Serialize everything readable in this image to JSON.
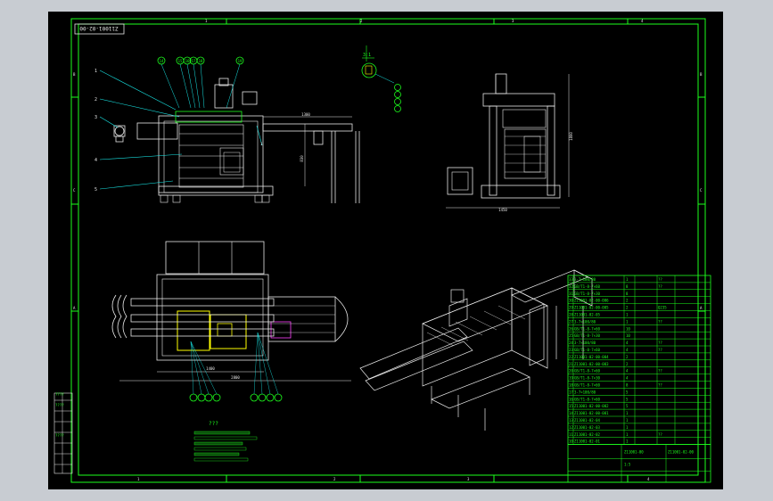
{
  "drawing": {
    "title_box_text": "Z11001-02-00",
    "dims": {
      "top_width": "1300",
      "top_height": "830",
      "side_width": "1450",
      "side_height": "1800",
      "plan_inner": "1400",
      "plan_outer": "2800"
    },
    "callouts_left": [
      "1",
      "2",
      "3",
      "4",
      "5"
    ],
    "callouts_top": [
      "14",
      "15",
      "16",
      "17",
      "18",
      "19"
    ],
    "detail_label": "3:1",
    "notes_title": "???",
    "border_letters_left": [
      "B",
      "C",
      "A"
    ],
    "border_letters_right": [
      "B",
      "C",
      "A"
    ],
    "border_numbers_top": [
      "1",
      "2",
      "3",
      "4"
    ],
    "border_numbers_bottom": [
      "1",
      "2",
      "3",
      "4"
    ]
  },
  "bom": {
    "rows": [
      {
        "no": "33",
        "code": "3-7×100/80",
        "qty": "1",
        "mat": "??"
      },
      {
        "no": "32",
        "code": "GB/T1-8-7×60",
        "qty": "8",
        "mat": "??"
      },
      {
        "no": "31",
        "code": "GB/T1-8-7×30",
        "qty": "8",
        "mat": ""
      },
      {
        "no": "30",
        "code": "Z11001-02-00-006",
        "qty": "2",
        "mat": ""
      },
      {
        "no": "29",
        "code": "Z11001-02-00-005",
        "qty": "2",
        "mat": "Q235"
      },
      {
        "no": "28",
        "code": "Z11001-02-05",
        "qty": "1",
        "mat": ""
      },
      {
        "no": "27",
        "code": "3-7×100/80",
        "qty": "1",
        "mat": "??"
      },
      {
        "no": "26",
        "code": "GB/T1-8-7×60",
        "qty": "10",
        "mat": ""
      },
      {
        "no": "25",
        "code": "GB/T1-8-7×30",
        "qty": "10",
        "mat": ""
      },
      {
        "no": "24",
        "code": "3-7×100/80",
        "qty": "4",
        "mat": "??"
      },
      {
        "no": "23",
        "code": "GB/T1-8-7×60",
        "qty": "4",
        "mat": "??"
      },
      {
        "no": "22",
        "code": "Z11001-02-00-004",
        "qty": "2",
        "mat": ""
      },
      {
        "no": "21",
        "code": "Z11001-02-00-003",
        "qty": "2",
        "mat": ""
      },
      {
        "no": "20",
        "code": "GB/T1-8-7×60",
        "qty": "4",
        "mat": "??"
      },
      {
        "no": "19",
        "code": "GB/T1-8-7×30",
        "qty": "4",
        "mat": ""
      },
      {
        "no": "18",
        "code": "GB/T1-8-7×60",
        "qty": "8",
        "mat": "??"
      },
      {
        "no": "17",
        "code": "3-7×100/80",
        "qty": "5",
        "mat": ""
      },
      {
        "no": "16",
        "code": "GB/T1-8-7×60",
        "qty": "5",
        "mat": ""
      },
      {
        "no": "15",
        "code": "Z11001-02-00-002",
        "qty": "5",
        "mat": ""
      },
      {
        "no": "14",
        "code": "Z11001-02-00-001",
        "qty": "1",
        "mat": ""
      },
      {
        "no": "13",
        "code": "Z11001-02-04",
        "qty": "1",
        "mat": ""
      },
      {
        "no": "12",
        "code": "Z11001-02-03",
        "qty": "1",
        "mat": ""
      },
      {
        "no": "11",
        "code": "Z11001-02-02",
        "qty": "1",
        "mat": "??"
      },
      {
        "no": "10",
        "code": "Z11001-02-01",
        "qty": "1",
        "mat": ""
      }
    ],
    "title_block": {
      "drawing_no": "Z11001-02-00",
      "scale": "Z11001-00",
      "sheet": "1:5"
    }
  }
}
